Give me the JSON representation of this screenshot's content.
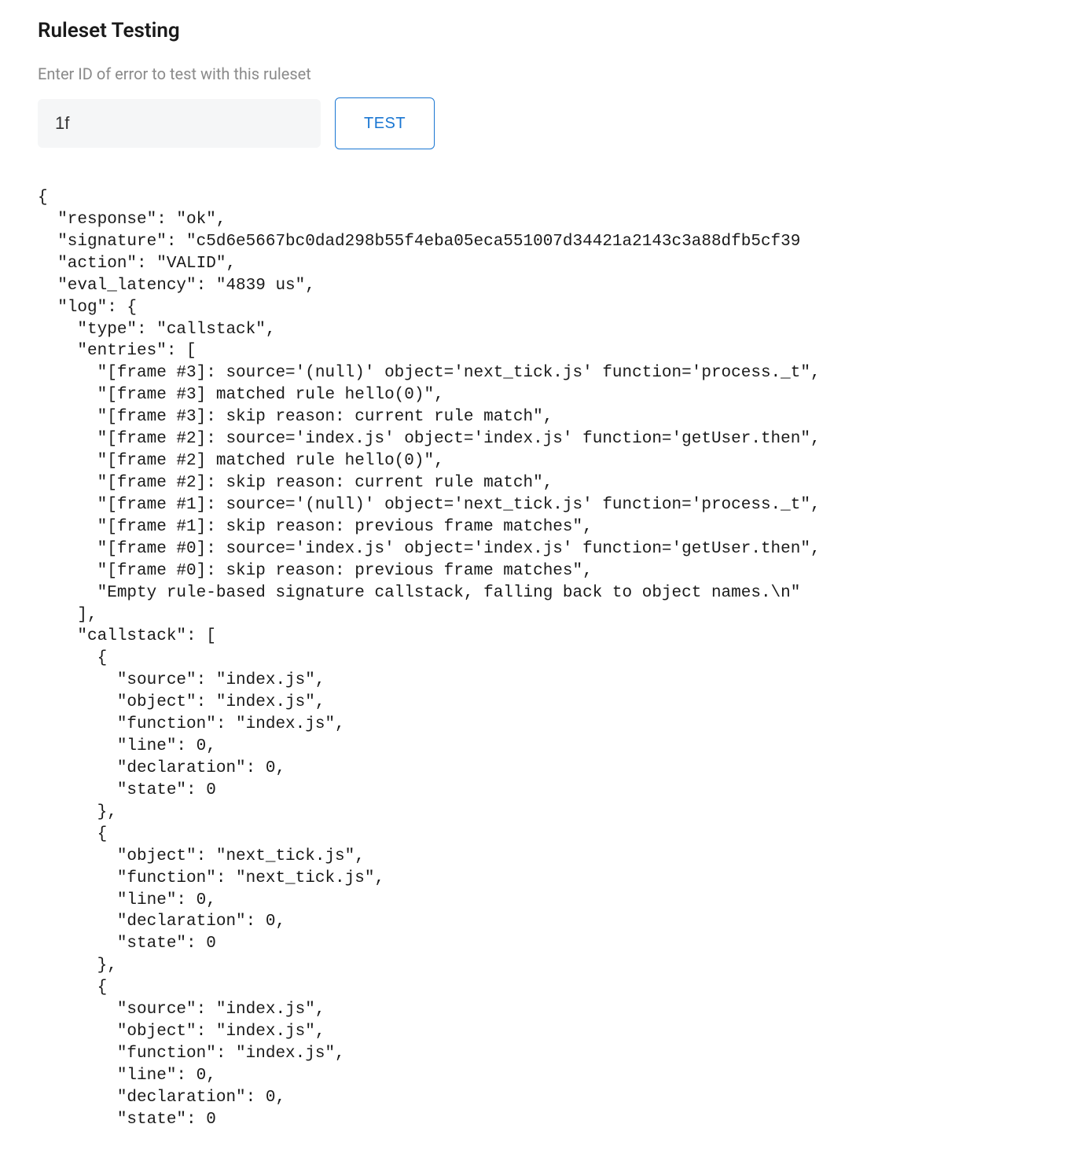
{
  "title": "Ruleset Testing",
  "subtitle": "Enter ID of error to test with this ruleset",
  "input_value": "1f",
  "button_label": "TEST",
  "result": {
    "response": "ok",
    "signature": "c5d6e5667bc0dad298b55f4eba05eca551007d34421a2143c3a88dfb5cf39",
    "action": "VALID",
    "eval_latency": "4839 us",
    "log": {
      "type": "callstack",
      "entries": [
        "[frame #3]: source='(null)' object='next_tick.js' function='process._t",
        "[frame #3] matched rule hello(0)",
        "[frame #3]: skip reason: current rule match",
        "[frame #2]: source='index.js' object='index.js' function='getUser.then",
        "[frame #2] matched rule hello(0)",
        "[frame #2]: skip reason: current rule match",
        "[frame #1]: source='(null)' object='next_tick.js' function='process._t",
        "[frame #1]: skip reason: previous frame matches",
        "[frame #0]: source='index.js' object='index.js' function='getUser.then",
        "[frame #0]: skip reason: previous frame matches",
        "Empty rule-based signature callstack, falling back to object names.\\n"
      ],
      "callstack": [
        {
          "source": "index.js",
          "object": "index.js",
          "function": "index.js",
          "line": 0,
          "declaration": 0,
          "state": 0
        },
        {
          "object": "next_tick.js",
          "function": "next_tick.js",
          "line": 0,
          "declaration": 0,
          "state": 0
        },
        {
          "source": "index.js",
          "object": "index.js",
          "function": "index.js",
          "line": 0,
          "declaration": 0,
          "state": 0
        }
      ]
    }
  }
}
